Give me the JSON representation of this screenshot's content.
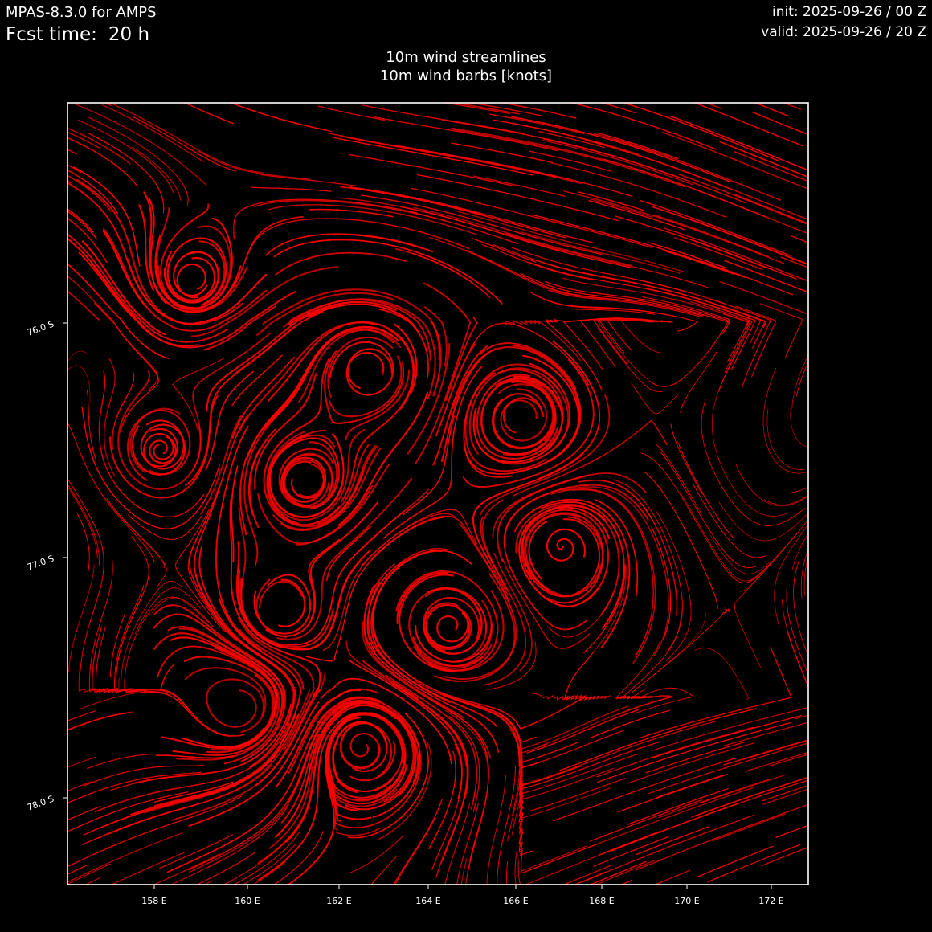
{
  "header": {
    "model": "MPAS-8.3.0 for AMPS",
    "fcst_label": "Fcst time:",
    "fcst_value": "20 h",
    "init": "init: 2025-09-26 / 00 Z",
    "valid": "valid: 2025-09-26 / 20 Z"
  },
  "titles": {
    "line1": "10m wind streamlines",
    "line2": "10m wind barbs [knots]"
  },
  "map": {
    "background": "#000000",
    "streamline_color": "#ff0000",
    "frame_color": "#ffffff",
    "x_ticks": [
      "158 E",
      "160 E",
      "162 E",
      "164 E",
      "166 E",
      "168 E",
      "170 E",
      "172 E"
    ],
    "y_ticks": [
      "76.0 S",
      "77.0 S",
      "78.0 S"
    ]
  }
}
